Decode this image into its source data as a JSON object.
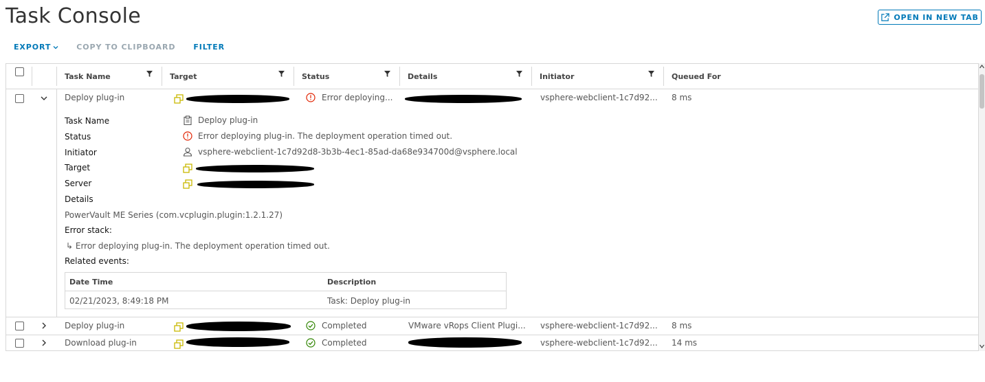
{
  "page": {
    "title": "Task Console",
    "open_new_tab": "OPEN IN NEW TAB"
  },
  "toolbar": {
    "export": "EXPORT",
    "copy": "COPY TO CLIPBOARD",
    "filter": "FILTER"
  },
  "columns": [
    "Task Name",
    "Target",
    "Status",
    "Details",
    "Initiator",
    "Queued For"
  ],
  "rows": [
    {
      "task": "Deploy plug-in",
      "status": "Error deploying...",
      "details": "",
      "initiator": "vsphere-webclient-1c7d92...",
      "queued": "8 ms"
    },
    {
      "task": "Deploy plug-in",
      "status": "Completed",
      "details": "VMware vRops Client Plugi...",
      "initiator": "vsphere-webclient-1c7d92...",
      "queued": "8 ms"
    },
    {
      "task": "Download plug-in",
      "status": "Completed",
      "details": "",
      "initiator": "vsphere-webclient-1c7d92...",
      "queued": "14 ms"
    }
  ],
  "detail": {
    "labels": {
      "task_name": "Task Name",
      "status": "Status",
      "initiator": "Initiator",
      "target": "Target",
      "server": "Server",
      "details": "Details",
      "error_stack": "Error stack:",
      "related_events": "Related events:"
    },
    "task_name": "Deploy plug-in",
    "status": "Error deploying plug-in. The deployment operation timed out.",
    "initiator": "vsphere-webclient-1c7d92d8-3b3b-4ec1-85ad-da68e934700d@vsphere.local",
    "details_text": "PowerVault ME Series (com.vcplugin.plugin:1.2.1.27)",
    "error_stack": "↳ Error deploying plug-in. The deployment operation timed out.",
    "events": {
      "headers": [
        "Date Time",
        "Description"
      ],
      "rows": [
        {
          "datetime": "02/21/2023, 8:49:18 PM",
          "description": "Task: Deploy plug-in"
        }
      ]
    }
  },
  "colors": {
    "accent": "#0079b8",
    "error": "#e12200",
    "success": "#2f8400",
    "vm_icon": "#c9b800"
  }
}
